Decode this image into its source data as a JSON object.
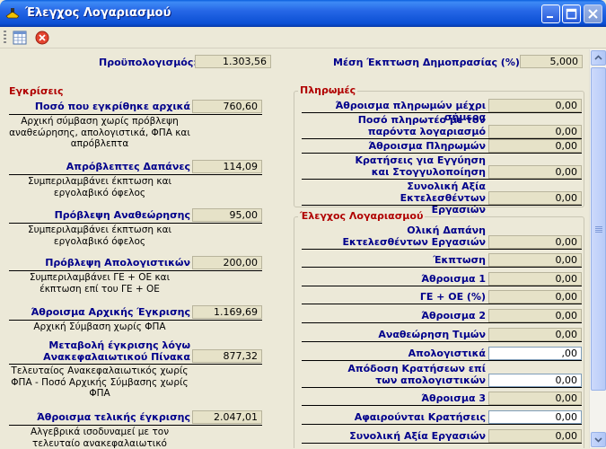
{
  "window": {
    "title": "Έλεγχος Λογαριασμού",
    "minimize_glyph": "minimize-icon",
    "maximize_glyph": "maximize-icon",
    "close_glyph": "close-icon"
  },
  "toolbar": {
    "items": [
      {
        "name": "grid-icon"
      },
      {
        "name": "cancel-icon"
      }
    ]
  },
  "header": {
    "budget_label": "Προϋπολογισμός:",
    "budget_value": "1.303,56",
    "discount_label": "Μέση Έκπτωση Δημοπρασίας (%):",
    "discount_value": "5,000"
  },
  "approvals": {
    "title": "Εγκρίσεις",
    "rows": [
      {
        "label": "Ποσό που εγκρίθηκε αρχικά",
        "value": "760,60",
        "note": "Αρχική σύμβαση χωρίς πρόβλεψη αναθεώρησης, απολογιστικά, ΦΠΑ και απρόβλεπτα"
      },
      {
        "label": "Απρόβλεπτες Δαπάνες",
        "value": "114,09",
        "note": "Συμπεριλαμβάνει έκπτωση και εργολαβικό όφελος"
      },
      {
        "label": "Πρόβλεψη Αναθεώρησης",
        "value": "95,00",
        "note": "Συμπεριλαμβάνει έκπτωση και εργολαβικό όφελος"
      },
      {
        "label": "Πρόβλεψη Απολογιστικών",
        "value": "200,00",
        "note": "Συμπεριλαμβάνει ΓΕ + ΟΕ και έκπτωση επί του ΓΕ + ΟΕ"
      },
      {
        "label": "Άθροισμα Αρχικής Έγκρισης",
        "value": "1.169,69",
        "note": "Αρχική Σύμβαση χωρίς ΦΠΑ"
      },
      {
        "label": "Μεταβολή έγκρισης λόγω Ανακεφαλαιωτικού Πίνακα",
        "value": "877,32",
        "note": "Τελευταίος Ανακεφαλαιωτικός χωρίς ΦΠΑ - Ποσό Αρχικής Σύμβασης χωρίς ΦΠΑ"
      },
      {
        "label": "Άθροισμα τελικής έγκρισης",
        "value": "2.047,01",
        "note": "Αλγεβρικά ισοδυναμεί με τον τελευταίο ανακεφαλαιωτικό"
      }
    ]
  },
  "payments": {
    "title": "Πληρωμές",
    "rows": [
      {
        "label": "Άθροισμα πληρωμών μέχρι σήμερα",
        "value": "0,00"
      },
      {
        "label": "Ποσό πληρωτέο με τον παρόντα λογαριασμό",
        "value": "0,00"
      },
      {
        "label": "Άθροισμα Πληρωμών",
        "value": "0,00"
      },
      {
        "label": "Κρατήσεις για Εγγύηση και Στογγυλοποίηση",
        "value": "0,00"
      },
      {
        "label": "Συνολική Αξία Εκτελεσθέντων Εργασιών",
        "value": "0,00"
      }
    ]
  },
  "account_check": {
    "title": "Έλεγχος Λογαριασμού",
    "rows": [
      {
        "label": "Ολική Δαπάνη Εκτελεσθέντων Εργασιών",
        "value": "0,00"
      },
      {
        "label": "Έκπτωση",
        "value": "0,00"
      },
      {
        "label": "Άθροισμα 1",
        "value": "0,00"
      },
      {
        "label": "ΓΕ + ΟΕ (%)",
        "value": "0,00"
      },
      {
        "label": "Άθροισμα 2",
        "value": "0,00"
      },
      {
        "label": "Αναθεώρηση Τιμών",
        "value": "0,00"
      },
      {
        "label": "Απολογιστικά",
        "value": ",00"
      },
      {
        "label": "Απόδοση Κρατήσεων επί των απολογιστικών",
        "value": "0,00"
      },
      {
        "label": "Άθροισμα 3",
        "value": "0,00"
      },
      {
        "label": "Αφαιρούνται Κρατήσεις",
        "value": "0,00"
      },
      {
        "label": "Συνολική Αξία Εργασιών",
        "value": "0,00"
      }
    ]
  }
}
